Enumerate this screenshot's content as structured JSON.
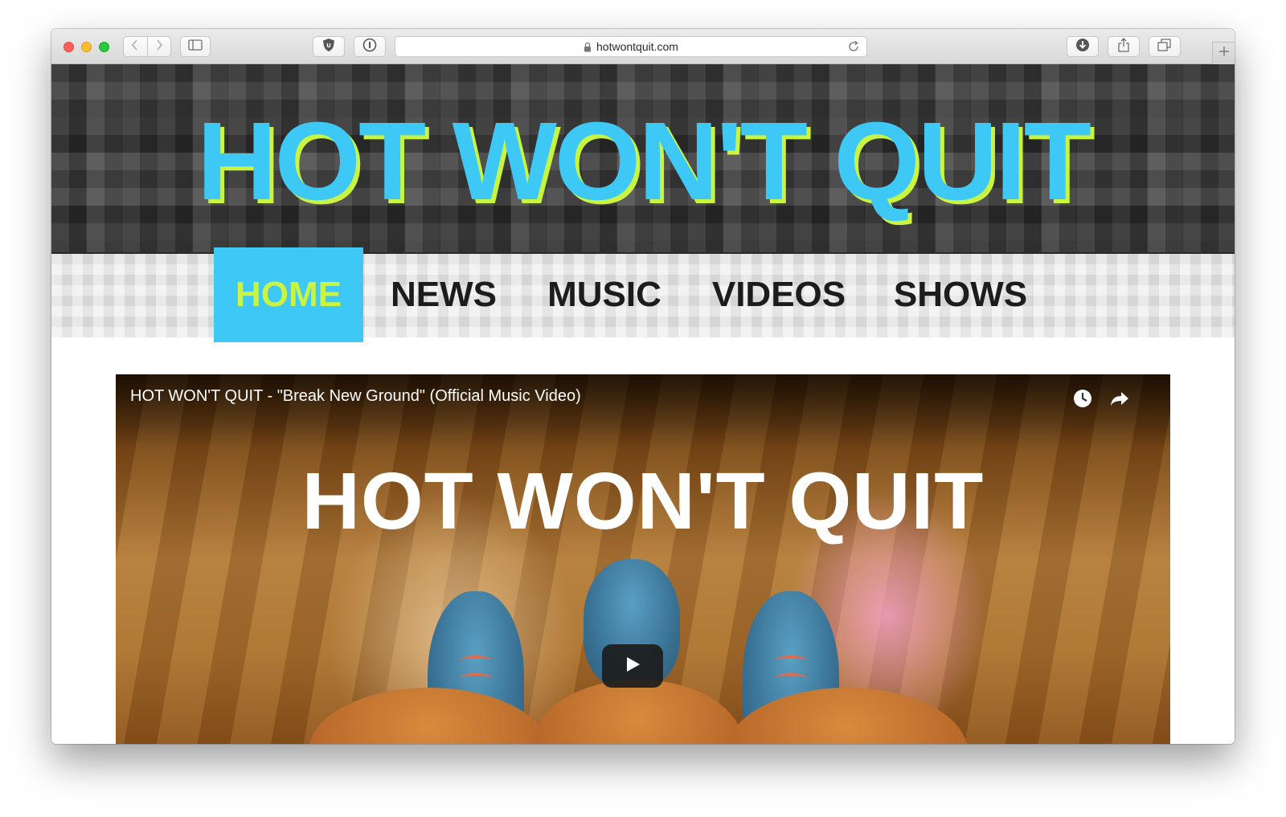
{
  "browser": {
    "url": "hotwontquit.com"
  },
  "site": {
    "title": "HOT WON'T QUIT",
    "colors": {
      "accent": "#3ec8f5",
      "highlight": "#c9f542"
    }
  },
  "nav": {
    "items": [
      {
        "label": "HOME",
        "active": true
      },
      {
        "label": "NEWS",
        "active": false
      },
      {
        "label": "MUSIC",
        "active": false
      },
      {
        "label": "VIDEOS",
        "active": false
      },
      {
        "label": "SHOWS",
        "active": false
      }
    ]
  },
  "video": {
    "title": "HOT WON'T QUIT - \"Break New Ground\" (Official Music Video)",
    "overlay_text": "HOT WON'T QUIT",
    "icons": [
      "watch-later-icon",
      "share-icon",
      "play-icon"
    ]
  }
}
